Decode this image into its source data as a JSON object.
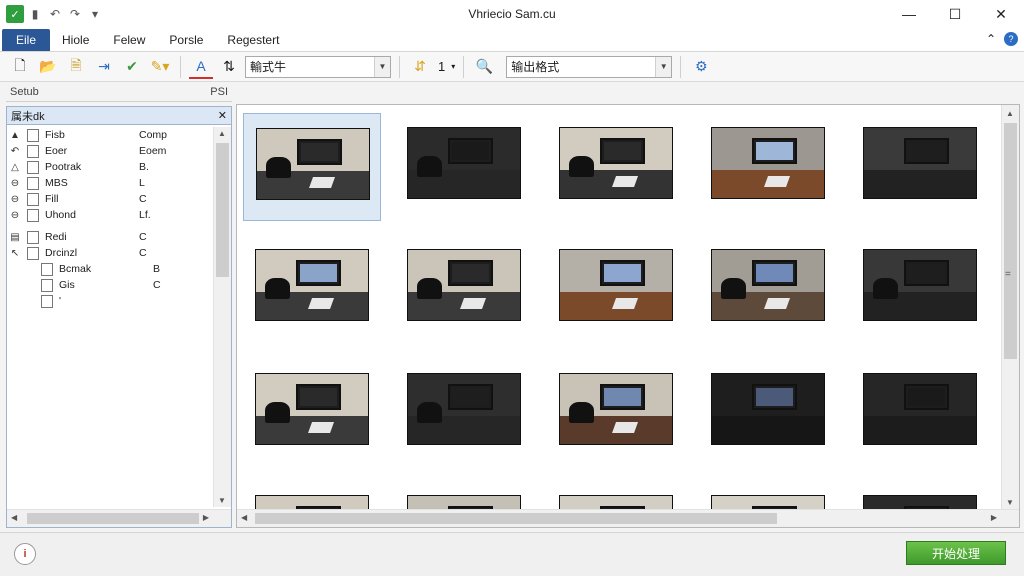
{
  "window": {
    "title": "Vhriecio Sam.cu",
    "controls": [
      "—",
      "☐",
      "✕"
    ]
  },
  "quick_access": [
    "save-icon",
    "undo-icon",
    "redo-icon",
    "customize-icon"
  ],
  "tabs": [
    {
      "label": "Eile"
    },
    {
      "label": "Hiole"
    },
    {
      "label": "Felew"
    },
    {
      "label": "Porsle"
    },
    {
      "label": "Regestert"
    }
  ],
  "toolbar": {
    "combo1": "輸式牛",
    "number": "1",
    "combo2": "输出格式"
  },
  "left_panel": {
    "header_left": "Setub",
    "header_right": "PSI",
    "title": "属未dk",
    "close": "✕",
    "rows": [
      {
        "exp": "▲",
        "name": "Fisb",
        "value": "Comp"
      },
      {
        "exp": "↶",
        "name": "Eoer",
        "value": "Eoem"
      },
      {
        "exp": "△",
        "name": "Pootrak",
        "value": "B."
      },
      {
        "exp": "⊖",
        "name": "MBS",
        "value": "L"
      },
      {
        "exp": "⊖",
        "name": "Fill",
        "value": "C"
      },
      {
        "exp": "⊖",
        "name": "Uhond",
        "value": "Lf."
      },
      {
        "exp": "▤",
        "name": "Redi",
        "value": "C"
      },
      {
        "exp": "↖",
        "name": "Drcinzl",
        "value": "C"
      },
      {
        "exp": "",
        "name": "Bcmak",
        "value": "B"
      },
      {
        "exp": "",
        "name": "Gis",
        "value": "C"
      },
      {
        "exp": "",
        "name": "'",
        "value": ""
      }
    ]
  },
  "status": {
    "icon": "i",
    "start_button": "开始处理"
  },
  "colors": {
    "file_tab": "#2b5797",
    "start_button": "#4caf36",
    "selection": "#dde8f5"
  }
}
